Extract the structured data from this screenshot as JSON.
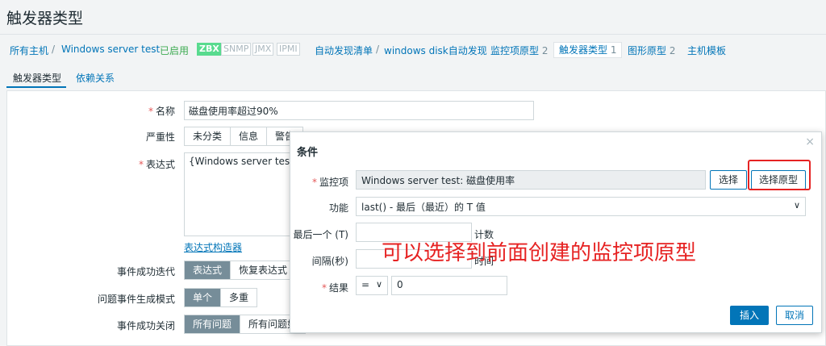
{
  "page": {
    "title": "触发器类型"
  },
  "nav": {
    "all_hosts": "所有主机",
    "sep": "/",
    "host": "Windows server test",
    "enabled": "已启用",
    "tags": [
      "ZBX",
      "SNMP",
      "JMX",
      "IPMI"
    ],
    "discovery_list": "自动发现清单",
    "sep2": "/",
    "discovery_rule": "windows disk自动发现",
    "item_protos": "监控项原型",
    "item_protos_count": "2",
    "trigger_protos": "触发器类型",
    "trigger_protos_count": "1",
    "graph_protos": "图形原型",
    "graph_protos_count": "2",
    "host_protos": "主机模板"
  },
  "tabs": {
    "trigger": "触发器类型",
    "deps": "依赖关系"
  },
  "form": {
    "name_label": "名称",
    "name_value": "磁盘使用率超过90%",
    "severity_label": "严重性",
    "severity_opts": [
      "未分类",
      "信息",
      "警告"
    ],
    "expr_label": "表达式",
    "expr_value": "{Windows server test:vfs",
    "expr_builder": "表达式构造器",
    "ok_event_gen_label": "事件成功迭代",
    "ok_event_gen_opts": [
      "表达式",
      "恢复表达式"
    ],
    "problem_mode_label": "问题事件生成模式",
    "problem_mode_opts": [
      "单个",
      "多重"
    ],
    "ok_close_label": "事件成功关闭",
    "ok_close_opts": [
      "所有问题",
      "所有问题如"
    ]
  },
  "dialog": {
    "title": "条件",
    "close": "×",
    "item_label": "监控项",
    "item_value": "Windows server test: 磁盘使用率",
    "select": "选择",
    "select_proto": "选择原型",
    "function_label": "功能",
    "function_value": "last() - 最后（最近）的 T 值",
    "last_of_label": "最后一个 (T)",
    "last_of_unit": "计数",
    "interval_label": "间隔(秒)",
    "interval_unit": "时间",
    "result_label": "结果",
    "result_op": "=",
    "result_value": "0",
    "insert": "插入",
    "cancel": "取消"
  },
  "annotation": "可以选择到前面创建的监控项原型",
  "colors": {
    "accent": "#0275b8",
    "highlight": "#e62222",
    "zbx_green": "#59db8f"
  }
}
